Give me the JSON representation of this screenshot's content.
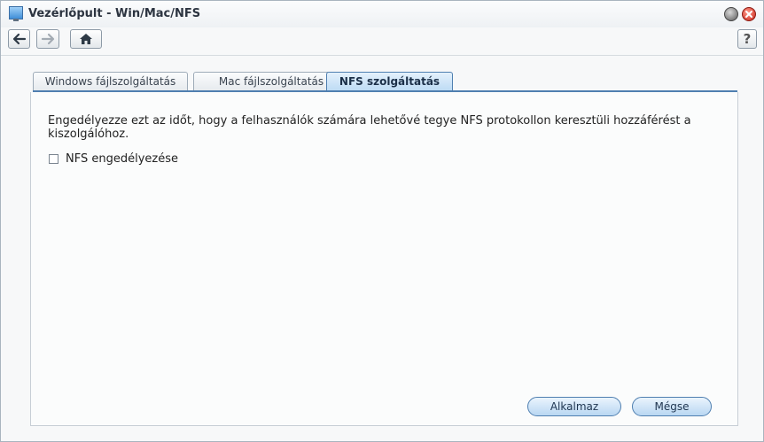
{
  "window": {
    "title": "Vezérlőpult - Win/Mac/NFS",
    "app_icon": "control-panel-icon"
  },
  "toolbar": {
    "back_icon": "arrow-left-icon",
    "forward_icon": "arrow-right-icon",
    "home_icon": "home-icon",
    "help_label": "?"
  },
  "tabs": [
    {
      "label": "Windows fájlszolgáltatás",
      "active": false
    },
    {
      "label": "Mac fájlszolgáltatás",
      "active": false
    },
    {
      "label": "NFS szolgáltatás",
      "active": true
    }
  ],
  "content": {
    "description": "Engedélyezze ezt az időt, hogy a felhasználók számára lehetővé tegye NFS protokollon keresztüli hozzáférést a kiszolgálóhoz.",
    "enable_nfs": {
      "label": "NFS engedélyezése",
      "checked": false
    }
  },
  "buttons": {
    "apply": "Alkalmaz",
    "cancel": "Mégse"
  },
  "colors": {
    "accent": "#4f7fb0",
    "close": "#c8251a"
  }
}
